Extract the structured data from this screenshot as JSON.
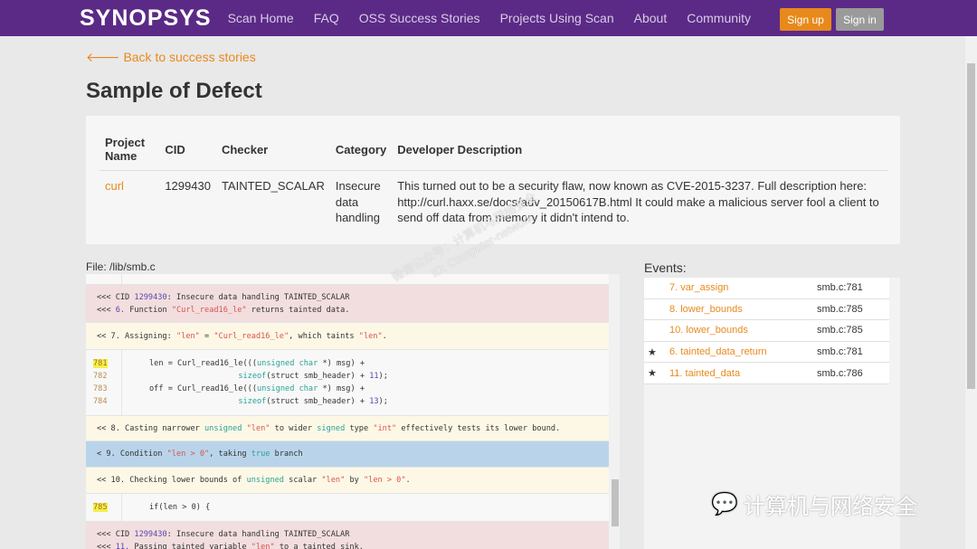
{
  "nav": {
    "logo": "SYNOPSYS",
    "links": [
      "Scan Home",
      "FAQ",
      "OSS Success Stories",
      "Projects Using Scan",
      "About",
      "Community"
    ],
    "signup": "Sign up",
    "signin": "Sign in"
  },
  "back": "Back to success stories",
  "title": "Sample of Defect",
  "defect": {
    "headers": [
      "Project Name",
      "CID",
      "Checker",
      "Category",
      "Developer Description"
    ],
    "project": "curl",
    "cid": "1299430",
    "checker": "TAINTED_SCALAR",
    "category": "Insecure data handling",
    "description": "This turned out to be a security flaw, now known as CVE-2015-3237. Full description here: http://curl.haxx.se/docs/adv_20150617B.html It could make a malicious server fool a client to send off data from memory it didn't intend to."
  },
  "file": "File: /lib/smb.c",
  "events_title": "Events:",
  "events": [
    {
      "label": "7. var_assign",
      "loc": "smb.c:781",
      "star": ""
    },
    {
      "label": "8. lower_bounds",
      "loc": "smb.c:785",
      "star": ""
    },
    {
      "label": "10. lower_bounds",
      "loc": "smb.c:785",
      "star": ""
    },
    {
      "label": "6. tainted_data_return",
      "loc": "smb.c:781",
      "star": "★"
    },
    {
      "label": "11. tainted_data",
      "loc": "smb.c:786",
      "star": "★"
    }
  ],
  "watermark": {
    "line1": "微信公众号：计算机与网络安全",
    "line2": "ID: Computer-network",
    "brand": "计算机与网络安全"
  },
  "colors": {
    "nav": "#5b2a86",
    "accent": "#e8891c"
  }
}
